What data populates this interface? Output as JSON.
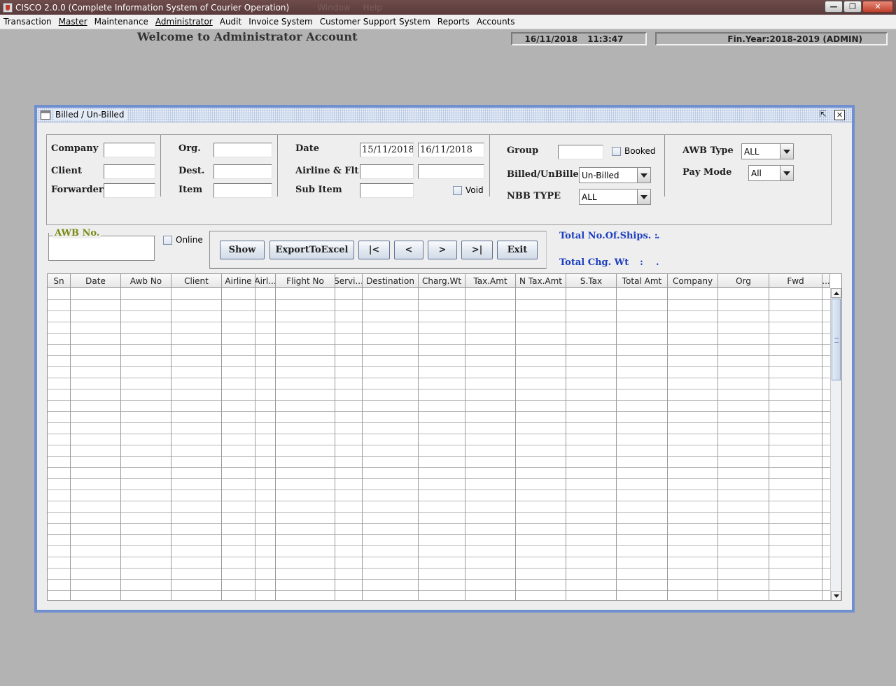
{
  "window": {
    "title": "CISCO 2.0.0 (Complete Information System of Courier Operation)",
    "ghost_menu": [
      "Window",
      "Help"
    ]
  },
  "menu": [
    "Transaction",
    "Master",
    "Maintenance",
    "Administrator",
    "Audit",
    "Invoice System",
    "Customer Support System",
    "Reports",
    "Accounts"
  ],
  "header": {
    "welcome": "Welcome to Administrator Account",
    "date": "16/11/2018",
    "time": "11:3:47",
    "fin_year": "Fin.Year:2018-2019  (ADMIN)"
  },
  "frame": {
    "title": "Billed / Un-Billed"
  },
  "criteria": {
    "company_label": "Company",
    "client_label": "Client",
    "forwarder_label": "Forwarder",
    "org_label": "Org.",
    "dest_label": "Dest.",
    "item_label": "Item",
    "date_label": "Date",
    "date_from": "15/11/2018",
    "date_to": "16/11/2018",
    "airline_label": "Airline & Flt",
    "subitem_label": "Sub Item",
    "void_label": "Void",
    "group_label": "Group",
    "booked_label": "Booked",
    "billed_label": "Billed/UnBilled",
    "billed_value": "Un-Billed",
    "nbb_label": "NBB TYPE",
    "nbb_value": "ALL",
    "awb_type_label": "AWB Type",
    "awb_type_value": "ALL",
    "paymode_label": "Pay Mode",
    "paymode_value": "All"
  },
  "awb": {
    "label": "AWB No.",
    "online_label": "Online"
  },
  "buttons": {
    "show": "Show",
    "export": "ExportToExcel",
    "first": "|<",
    "prev": "<",
    "next": ">",
    "last": ">|",
    "exit": "Exit"
  },
  "totals": {
    "ships_label": "Total No.Of.Ships. :",
    "ships_value": ".",
    "chgwt_label": "Total Chg. Wt",
    "chgwt_colon": ":",
    "chgwt_value": "."
  },
  "table": {
    "columns": [
      "Sn",
      "Date",
      "Awb No",
      "Client",
      "Airline",
      "Airl...",
      "Flight No",
      "Servi...",
      "Destination",
      "Charg.Wt",
      "Tax.Amt",
      "N Tax.Amt",
      "S.Tax",
      "Total Amt",
      "Company",
      "Org",
      "Fwd",
      "..."
    ]
  }
}
